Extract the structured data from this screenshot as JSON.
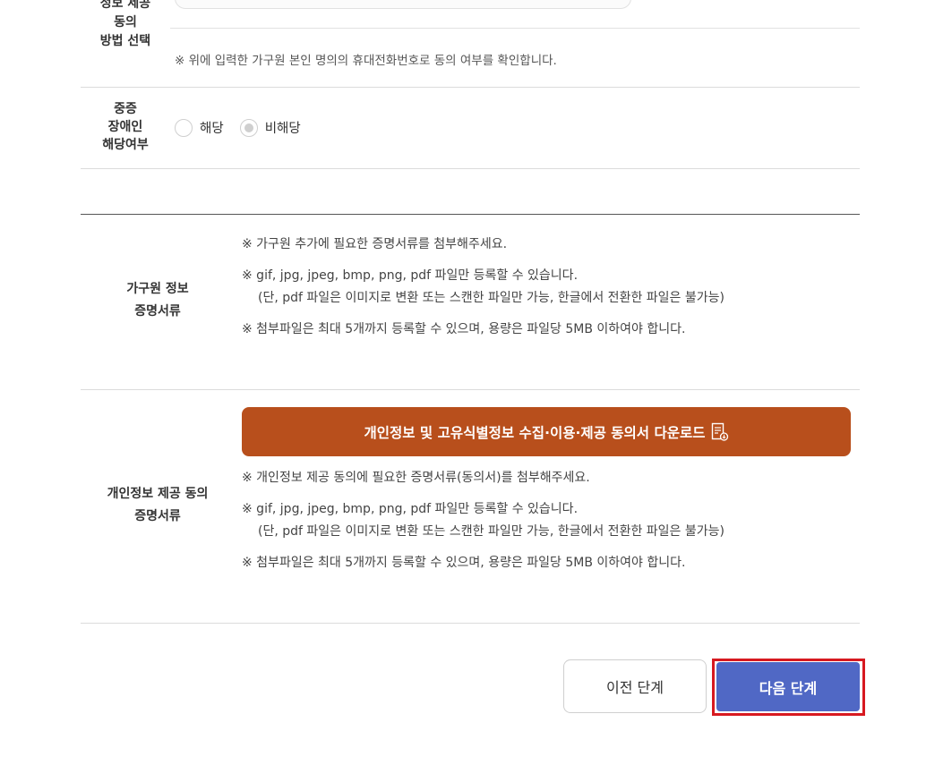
{
  "consent_method": {
    "label_lines": [
      "정보 제공",
      "동의",
      "방법 선택"
    ],
    "note": "※ 위에 입력한 가구원 본인 명의의 휴대전화번호로 동의 여부를 확인합니다."
  },
  "disability": {
    "label_lines": [
      "중증",
      "장애인",
      "해당여부"
    ],
    "options": [
      "해당",
      "비해당"
    ],
    "selected": "비해당"
  },
  "household_docs": {
    "label_lines": [
      "가구원 정보",
      "증명서류"
    ],
    "notes": [
      "※ 가구원 추가에 필요한 증명서류를 첨부해주세요.",
      "※ gif, jpg, jpeg, bmp, png, pdf 파일만 등록할 수 있습니다.",
      "(단, pdf 파일은 이미지로 변환 또는 스캔한 파일만 가능, 한글에서 전환한 파일은 불가능)",
      "※ 첨부파일은 최대 5개까지 등록할 수 있으며, 용량은 파일당 5MB 이하여야 합니다."
    ]
  },
  "privacy_docs": {
    "label_lines": [
      "개인정보 제공 동의",
      "증명서류"
    ],
    "download_label": "개인정보 및 고유식별정보 수집·이용·제공 동의서 다운로드",
    "notes": [
      "※ 개인정보 제공 동의에 필요한 증명서류(동의서)를 첨부해주세요.",
      "※ gif, jpg, jpeg, bmp, png, pdf 파일만 등록할 수 있습니다.",
      "(단, pdf 파일은 이미지로 변환 또는 스캔한 파일만 가능, 한글에서 전환한 파일은 불가능)",
      "※ 첨부파일은 최대 5개까지 등록할 수 있으며, 용량은 파일당 5MB 이하여야 합니다."
    ]
  },
  "buttons": {
    "prev_label": "이전 단계",
    "next_label": "다음 단계"
  },
  "colors": {
    "download_button": "#b84f1c",
    "next_button": "#5068c5",
    "highlight_frame": "#d71920"
  },
  "icons": {
    "download": "document-download-icon"
  }
}
